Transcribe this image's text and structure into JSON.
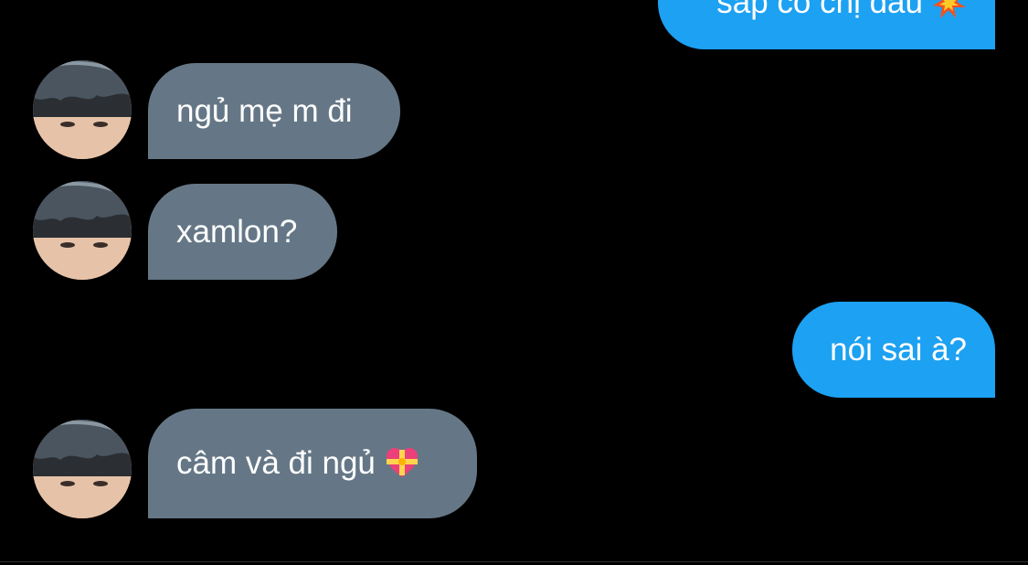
{
  "conversation": {
    "messages": [
      {
        "direction": "out",
        "text": "sắp có chị dâu",
        "emoji_icon": "collision-icon"
      },
      {
        "direction": "in",
        "text": "ngủ mẹ m đi"
      },
      {
        "direction": "in",
        "text": "xamlon?"
      },
      {
        "direction": "out",
        "text": "nói sai à?"
      },
      {
        "direction": "in",
        "text": "câm và đi ngủ",
        "emoji_icon": "heart-with-ribbon-icon"
      }
    ]
  },
  "colors": {
    "background": "#000000",
    "incoming_bubble": "#657786",
    "outgoing_bubble": "#1da1f2",
    "text": "#ffffff"
  }
}
